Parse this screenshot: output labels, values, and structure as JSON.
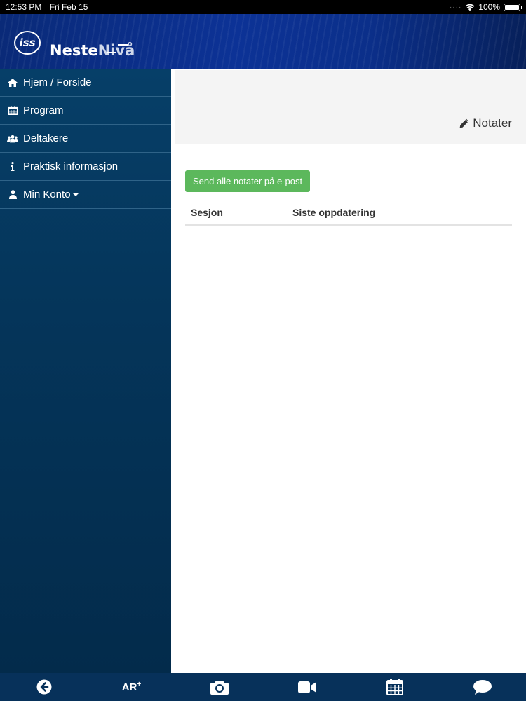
{
  "status_bar": {
    "time": "12:53 PM",
    "date": "Fri Feb 15",
    "battery": "100%"
  },
  "header": {
    "logo_mark": "iss",
    "brand_part1": "Neste",
    "brand_part2": "Nivå"
  },
  "sidebar": {
    "items": [
      {
        "label": "Hjem / Forside",
        "icon": "home-icon"
      },
      {
        "label": "Program",
        "icon": "calendar-icon"
      },
      {
        "label": "Deltakere",
        "icon": "users-icon"
      },
      {
        "label": "Praktisk informasjon",
        "icon": "info-icon"
      },
      {
        "label": "Min Konto",
        "icon": "user-icon"
      }
    ]
  },
  "main": {
    "title": "Notater",
    "send_button_label": "Send alle notater på e-post",
    "table": {
      "columns": [
        "Sesjon",
        "Siste oppdatering"
      ],
      "rows": []
    }
  },
  "toolbar": {
    "ar_label": "AR",
    "ar_sup": "+",
    "items": [
      "back-icon",
      "ar-icon",
      "camera-icon",
      "video-icon",
      "calendar-icon",
      "chat-icon"
    ]
  },
  "colors": {
    "sidebar_bg": "#05355a",
    "header_bg": "#0c3296",
    "accent_green": "#5cb85c",
    "toolbar_bg": "#07315a"
  }
}
